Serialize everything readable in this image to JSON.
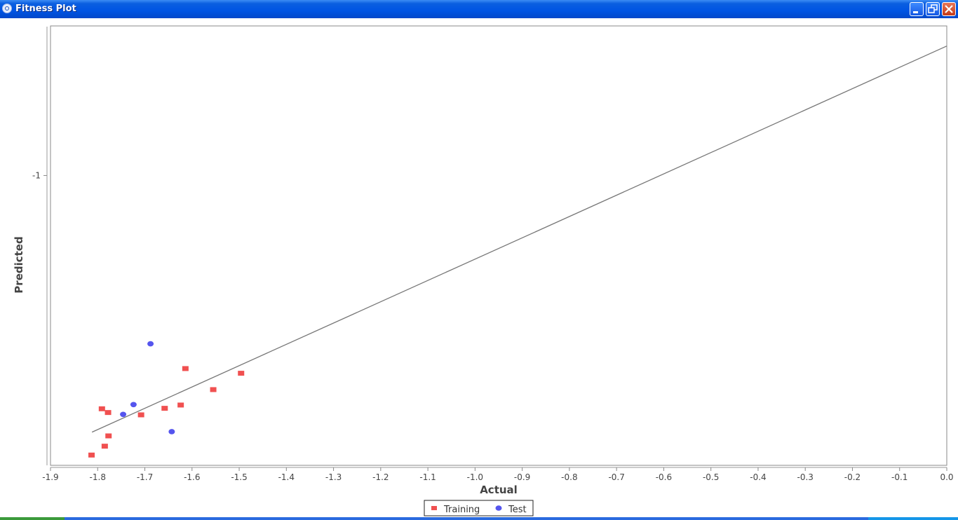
{
  "window": {
    "title": "Fitness Plot",
    "icon": "app-icon",
    "buttons": [
      "minimize-icon",
      "restore-icon",
      "close-icon"
    ]
  },
  "chart_data": {
    "type": "scatter",
    "title": "",
    "xlabel": "Actual",
    "ylabel": "Predicted",
    "xlim": [
      -1.9,
      0.0
    ],
    "ylim": [
      -1.62,
      -0.68
    ],
    "x_ticks": [
      -1.9,
      -1.8,
      -1.7,
      -1.6,
      -1.5,
      -1.4,
      -1.3,
      -1.2,
      -1.1,
      -1.0,
      -0.9,
      -0.8,
      -0.7,
      -0.6,
      -0.5,
      -0.4,
      -0.3,
      -0.2,
      -0.1,
      0.0
    ],
    "x_tick_labels": [
      "-1.9",
      "-1.8",
      "-1.7",
      "-1.6",
      "-1.5",
      "-1.4",
      "-1.3",
      "-1.2",
      "-1.1",
      "-1.0",
      "-0.9",
      "-0.8",
      "-0.7",
      "-0.6",
      "-0.5",
      "-0.4",
      "-0.3",
      "-0.2",
      "-0.1",
      "0.0"
    ],
    "y_ticks": [
      -1.0
    ],
    "y_tick_labels": [
      "-1"
    ],
    "grid": false,
    "legend_position": "bottom-center",
    "series": [
      {
        "name": "Training",
        "marker": "square",
        "color": "#f05050",
        "points": [
          {
            "x": -1.813,
            "y": -1.598
          },
          {
            "x": -1.785,
            "y": -1.579
          },
          {
            "x": -1.777,
            "y": -1.557
          },
          {
            "x": -1.791,
            "y": -1.499
          },
          {
            "x": -1.778,
            "y": -1.507
          },
          {
            "x": -1.708,
            "y": -1.512
          },
          {
            "x": -1.658,
            "y": -1.498
          },
          {
            "x": -1.624,
            "y": -1.491
          },
          {
            "x": -1.614,
            "y": -1.413
          },
          {
            "x": -1.555,
            "y": -1.458
          },
          {
            "x": -1.496,
            "y": -1.423
          }
        ]
      },
      {
        "name": "Test",
        "marker": "circle",
        "color": "#5555ee",
        "points": [
          {
            "x": -1.746,
            "y": -1.511
          },
          {
            "x": -1.724,
            "y": -1.49
          },
          {
            "x": -1.688,
            "y": -1.36
          },
          {
            "x": -1.643,
            "y": -1.548
          }
        ]
      }
    ],
    "fit_line": {
      "color": "#777777",
      "points": [
        {
          "x": -1.812,
          "y": -1.549
        },
        {
          "x": 0.0,
          "y": -0.723
        }
      ]
    }
  }
}
